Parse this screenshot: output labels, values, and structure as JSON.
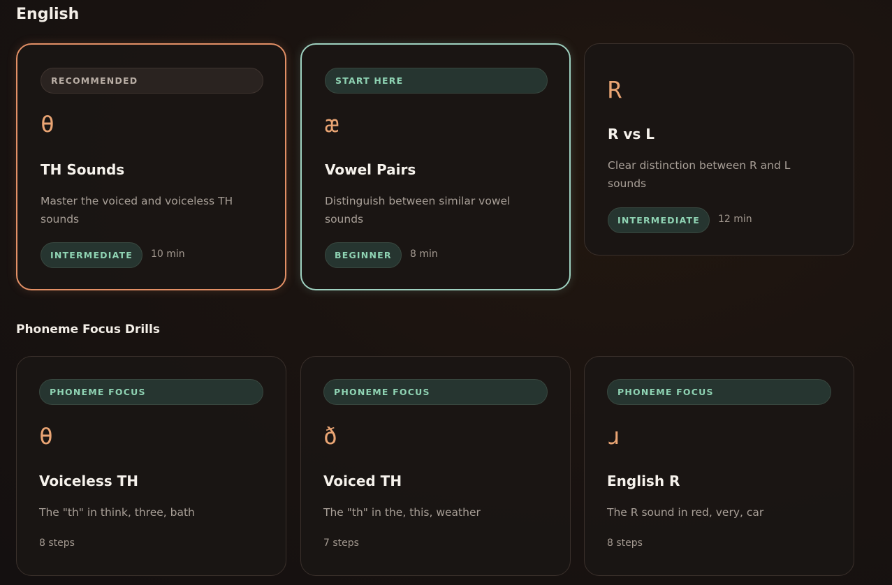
{
  "sections": {
    "english": {
      "title": "English",
      "cards": [
        {
          "badge": "RECOMMENDED",
          "symbol": "θ",
          "title": "TH Sounds",
          "description": "Master the voiced and voiceless TH sounds",
          "level": "INTERMEDIATE",
          "duration": "10 min",
          "highlight": "#e39066"
        },
        {
          "badge": "START HERE",
          "symbol": "æ",
          "title": "Vowel Pairs",
          "description": "Distinguish between similar vowel sounds",
          "level": "BEGINNER",
          "duration": "8 min",
          "highlight": "#9fd2c1"
        },
        {
          "symbol": "R",
          "title": "R vs L",
          "description": "Clear distinction between R and L sounds",
          "level": "INTERMEDIATE",
          "duration": "12 min"
        }
      ]
    },
    "drills": {
      "title": "Phoneme Focus Drills",
      "cards": [
        {
          "badge": "PHONEME FOCUS",
          "symbol": "θ",
          "title": "Voiceless TH",
          "description": "The \"th\" in think, three, bath",
          "steps": "8 steps"
        },
        {
          "badge": "PHONEME FOCUS",
          "symbol": "ð",
          "title": "Voiced TH",
          "description": "The \"th\" in the, this, weather",
          "steps": "7 steps"
        },
        {
          "badge": "PHONEME FOCUS",
          "symbol": "ɹ",
          "title": "English R",
          "description": "The R sound in red, very, car",
          "steps": "8 steps"
        }
      ]
    }
  },
  "colors": {
    "accent_orange": "#e39066",
    "accent_teal": "#9fd2c1",
    "symbol": "#eaa574",
    "level_text": "#8fd3b3"
  }
}
